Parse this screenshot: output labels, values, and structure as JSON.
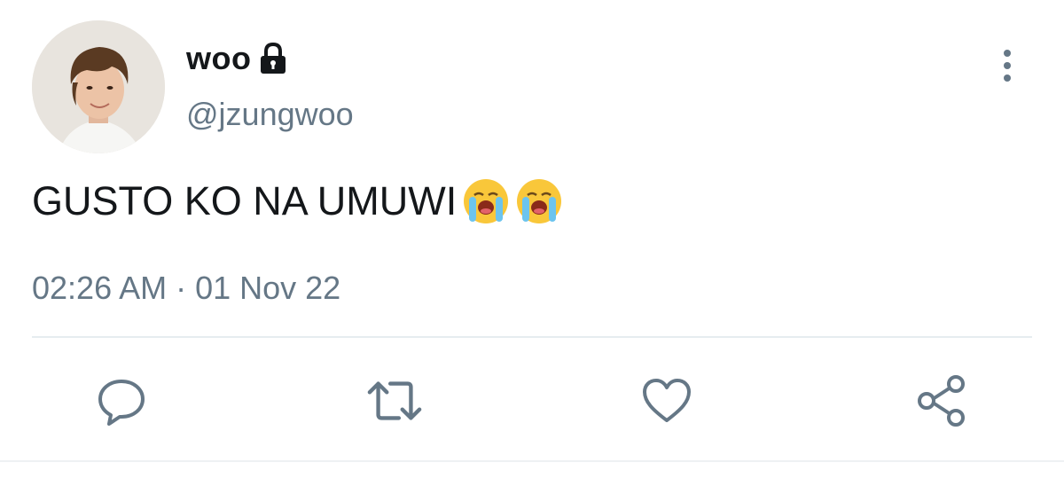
{
  "tweet": {
    "author": {
      "display_name": "woo",
      "handle": "@jzungwoo",
      "protected": true,
      "avatar": "profile-photo"
    },
    "text": "GUSTO KO NA UMUWI",
    "emojis": [
      "loudly-crying-face",
      "loudly-crying-face"
    ],
    "timestamp": "02:26 AM · 01 Nov 22"
  },
  "actions": [
    {
      "name": "reply",
      "icon": "speech-bubble-icon"
    },
    {
      "name": "retweet",
      "icon": "retweet-arrows-icon"
    },
    {
      "name": "like",
      "icon": "heart-icon"
    },
    {
      "name": "share",
      "icon": "share-nodes-icon"
    }
  ],
  "colors": {
    "text": "#14171a",
    "secondary": "#657786",
    "divider": "#e6ecf0"
  }
}
